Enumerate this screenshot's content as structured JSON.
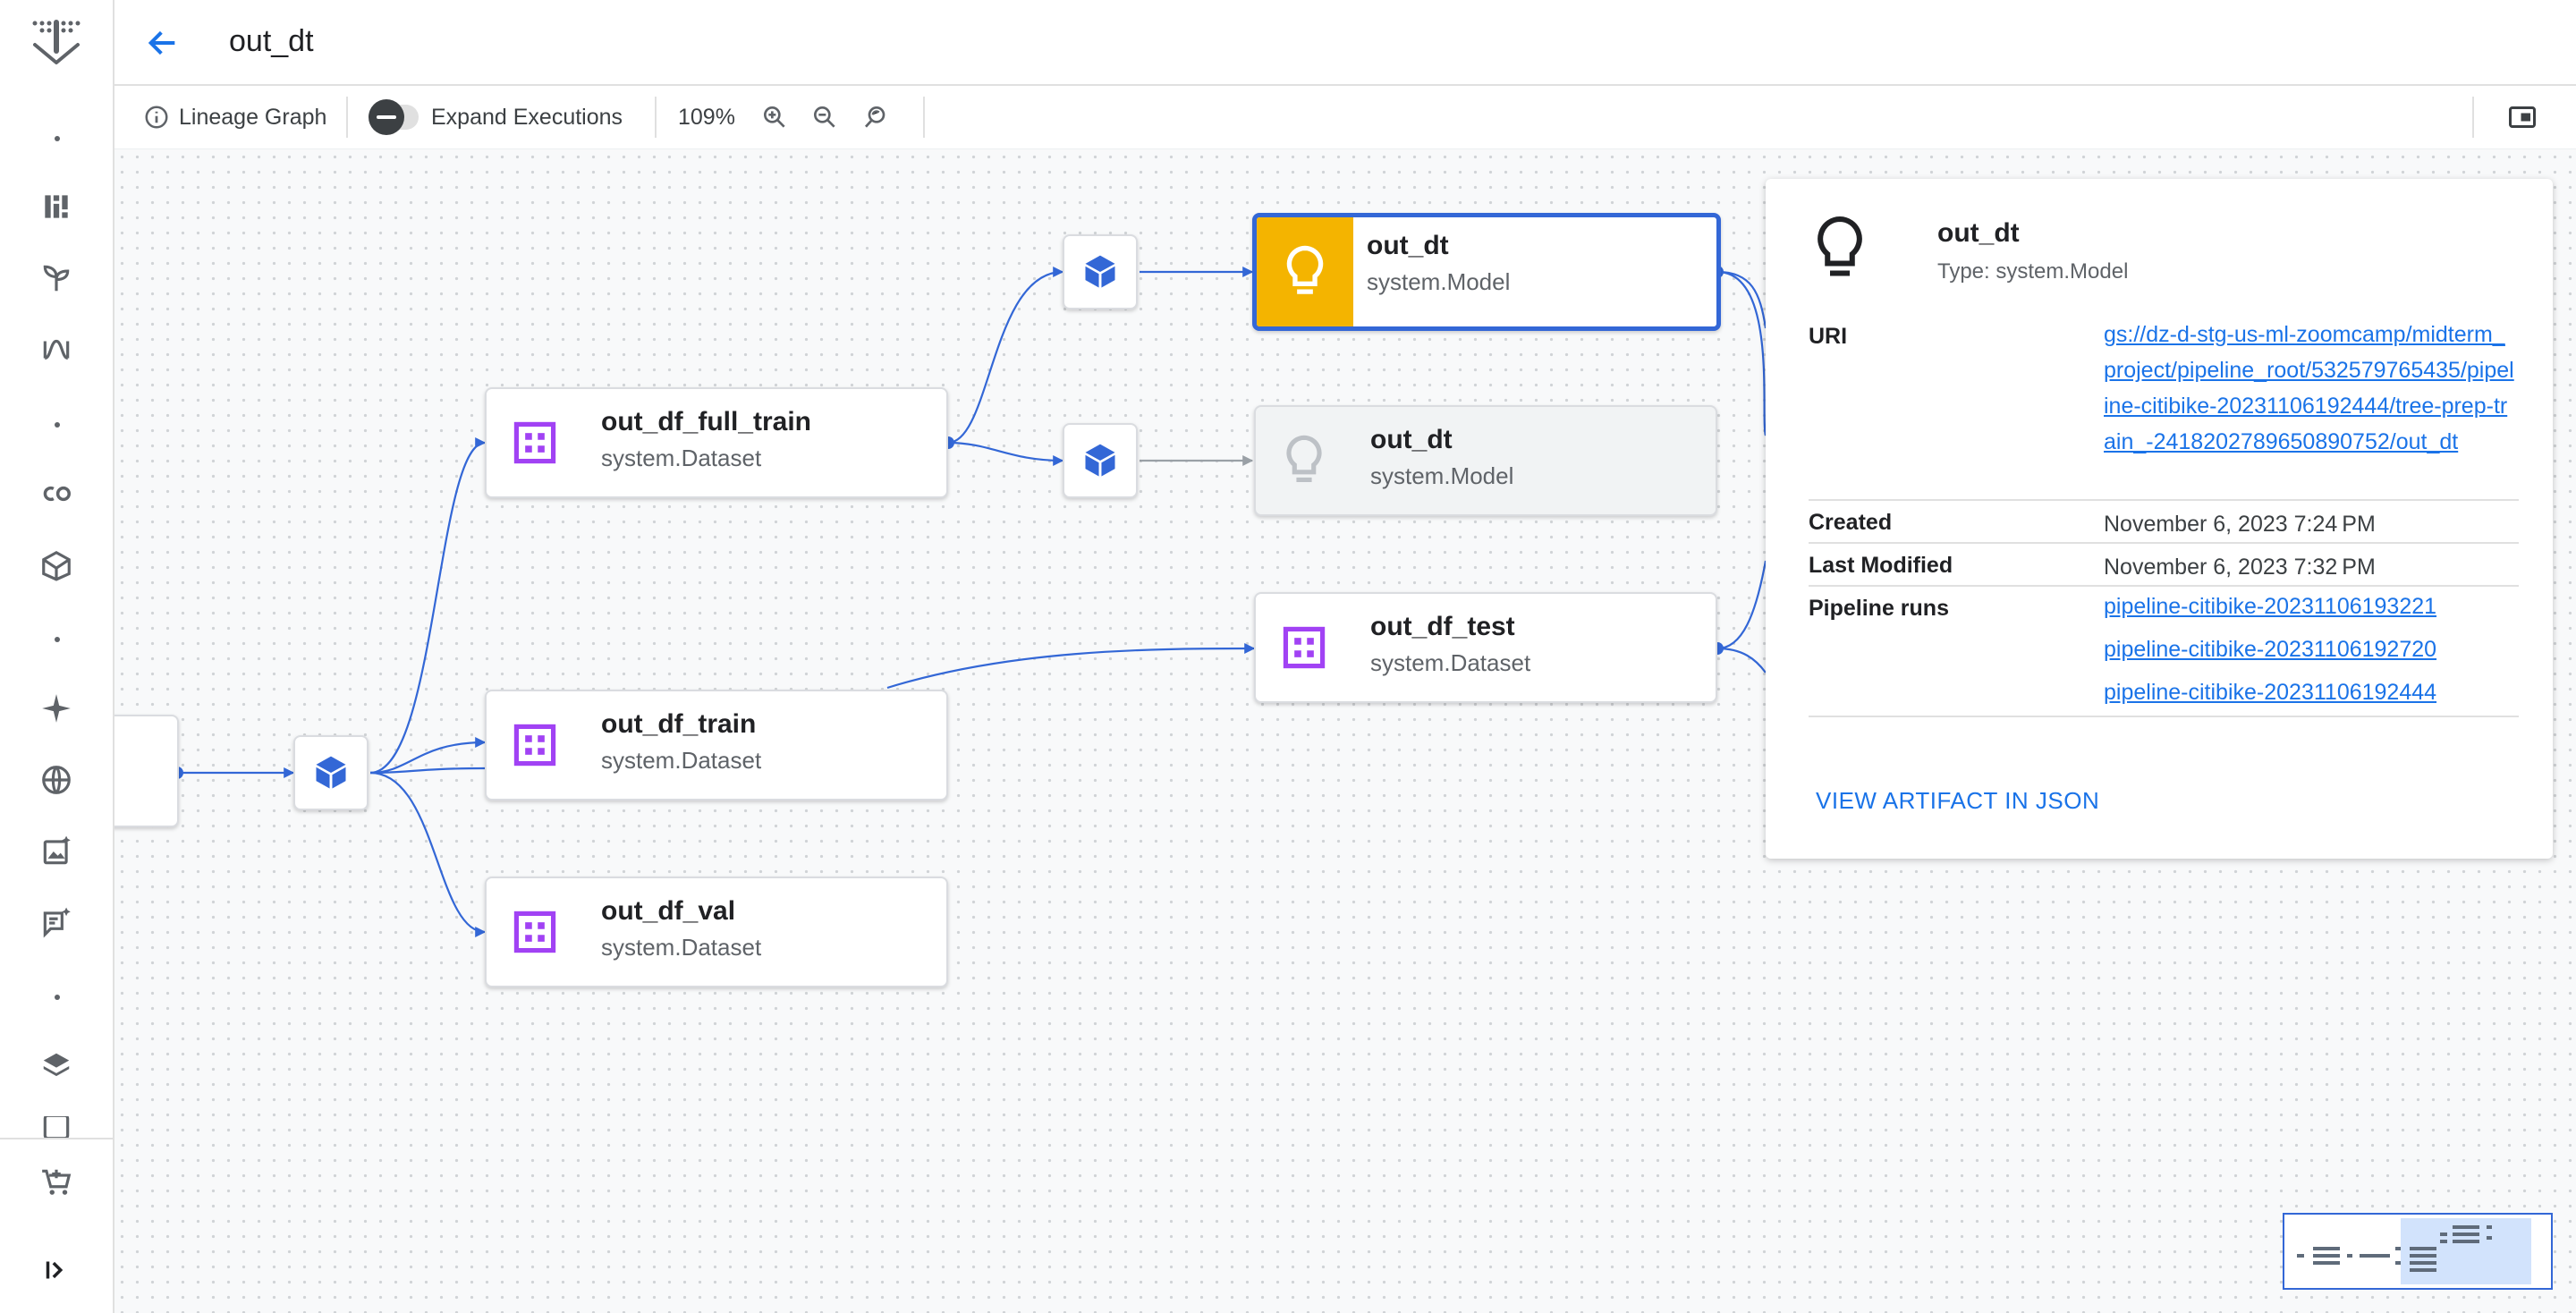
{
  "header": {
    "title": "out_dt"
  },
  "toolbar": {
    "lineage_label": "Lineage Graph",
    "expand_label": "Expand Executions",
    "zoom_level": "109%"
  },
  "nodes": {
    "full_train": {
      "title": "out_df_full_train",
      "type": "system.Dataset"
    },
    "train": {
      "title": "out_df_train",
      "type": "system.Dataset"
    },
    "val": {
      "title": "out_df_val",
      "type": "system.Dataset"
    },
    "model_selected": {
      "title": "out_dt",
      "type": "system.Model"
    },
    "model_other": {
      "title": "out_dt",
      "type": "system.Model"
    },
    "test": {
      "title": "out_df_test",
      "type": "system.Dataset"
    }
  },
  "panel": {
    "title": "out_dt",
    "type": "Type: system.Model",
    "uri_label": "URI",
    "uri_value": "gs://dz-d-stg-us-ml-zoomcamp/midterm_project/pipeline_root/532579765435/pipeline-citibike-20231106192444/tree-prep-train_-2418202789650890752/out_dt",
    "created_label": "Created",
    "created_value": "November 6, 2023 7:24 PM",
    "modified_label": "Last Modified",
    "modified_value": "November 6, 2023 7:32 PM",
    "runs_label": "Pipeline runs",
    "runs": [
      "pipeline-citibike-20231106193221",
      "pipeline-citibike-20231106192720",
      "pipeline-citibike-20231106192444"
    ],
    "action": "VIEW ARTIFACT IN JSON"
  },
  "colors": {
    "accent": "#3367d6",
    "model_highlight": "#f4b400",
    "dataset_icon": "#a142f4",
    "link": "#1a73e8"
  }
}
